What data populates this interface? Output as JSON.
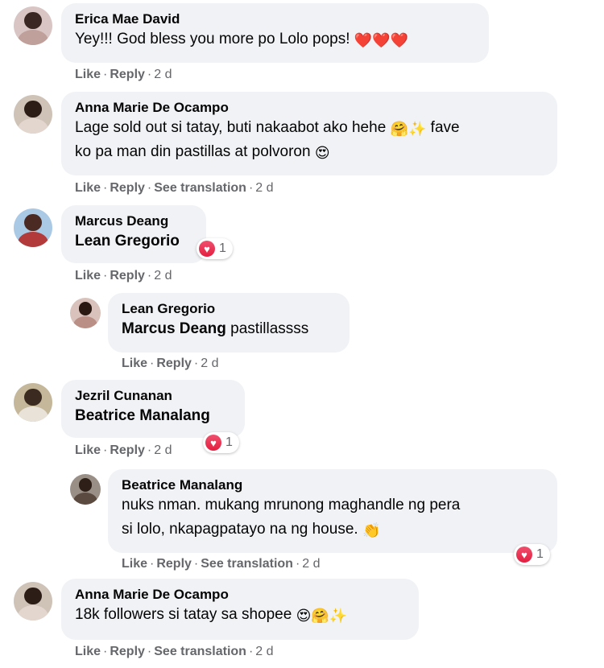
{
  "comments": [
    {
      "author": "Erica Mae David",
      "text": "Yey!!! God bless you more po Lolo pops!",
      "emoji": [
        "❤️",
        "❤️",
        "❤️"
      ],
      "actions": {
        "like": "Like",
        "reply": "Reply",
        "time": "2 d"
      }
    },
    {
      "author": "Anna Marie De Ocampo",
      "text_line1": "Lage sold out si tatay, buti nakaabot ako hehe",
      "emoji_line1": [
        "🤗",
        "✨"
      ],
      "text_line1b": "fave",
      "text_line2": "ko pa man din pastillas at polvoron",
      "emoji_line2": [
        "😍"
      ],
      "actions": {
        "like": "Like",
        "reply": "Reply",
        "translate": "See translation",
        "time": "2 d"
      }
    },
    {
      "author": "Marcus Deang",
      "mention": "Lean Gregorio",
      "reaction_count": "1",
      "actions": {
        "like": "Like",
        "reply": "Reply",
        "time": "2 d"
      }
    },
    {
      "author": "Lean Gregorio",
      "mention": "Marcus Deang",
      "text": "pastillassss",
      "actions": {
        "like": "Like",
        "reply": "Reply",
        "time": "2 d"
      }
    },
    {
      "author": "Jezril Cunanan",
      "mention": "Beatrice Manalang",
      "reaction_count": "1",
      "actions": {
        "like": "Like",
        "reply": "Reply",
        "time": "2 d"
      }
    },
    {
      "author": "Beatrice Manalang",
      "text_line1": "nuks nman. mukang mrunong maghandle ng pera",
      "text_line2": "si lolo, nkapagpatayo na ng house.",
      "emoji_line2": [
        "👏"
      ],
      "reaction_count": "1",
      "actions": {
        "like": "Like",
        "reply": "Reply",
        "translate": "See translation",
        "time": "2 d"
      }
    },
    {
      "author": "Anna Marie De Ocampo",
      "text": "18k followers si tatay sa shopee",
      "emoji": [
        "😍",
        "🤗",
        "✨"
      ],
      "actions": {
        "like": "Like",
        "reply": "Reply",
        "translate": "See translation",
        "time": "2 d"
      }
    }
  ],
  "reaction_icon": "heart-icon",
  "colors": {
    "bubble": "#f0f2f5",
    "meta": "#65676b",
    "heart": "#e41e3f"
  }
}
